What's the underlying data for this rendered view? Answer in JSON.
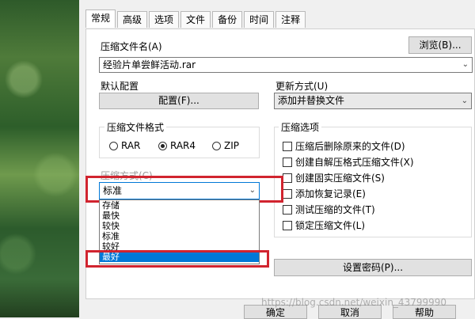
{
  "tabs": [
    "常规",
    "高级",
    "选项",
    "文件",
    "备份",
    "时间",
    "注释"
  ],
  "archive_name_label": "压缩文件名(A)",
  "archive_name_value": "经验片单尝鲜活动.rar",
  "browse_button": "浏览(B)...",
  "default_profile_label": "默认配置",
  "profile_button": "配置(F)...",
  "update_mode_label": "更新方式(U)",
  "update_mode_value": "添加并替换文件",
  "format_group": "压缩文件格式",
  "formats": [
    {
      "label": "RAR",
      "selected": false
    },
    {
      "label": "RAR4",
      "selected": true
    },
    {
      "label": "ZIP",
      "selected": false
    }
  ],
  "options_group": "压缩选项",
  "options": [
    "压缩后删除原来的文件(D)",
    "创建自解压格式压缩文件(X)",
    "创建固实压缩文件(S)",
    "添加恢复记录(E)",
    "测试压缩的文件(T)",
    "锁定压缩文件(L)"
  ],
  "method_label": "压缩方式(C)",
  "method_value": "标准",
  "method_options": [
    "存储",
    "最快",
    "较快",
    "标准",
    "较好",
    "最好"
  ],
  "method_selected_index": 5,
  "set_password_button": "设置密码(P)...",
  "ok_button": "确定",
  "cancel_button": "取消",
  "help_button": "帮助",
  "watermark": "https://blog.csdn.net/weixin_43799990",
  "colors": {
    "highlight": "#0078d7",
    "annotation_red": "#d1242f"
  }
}
